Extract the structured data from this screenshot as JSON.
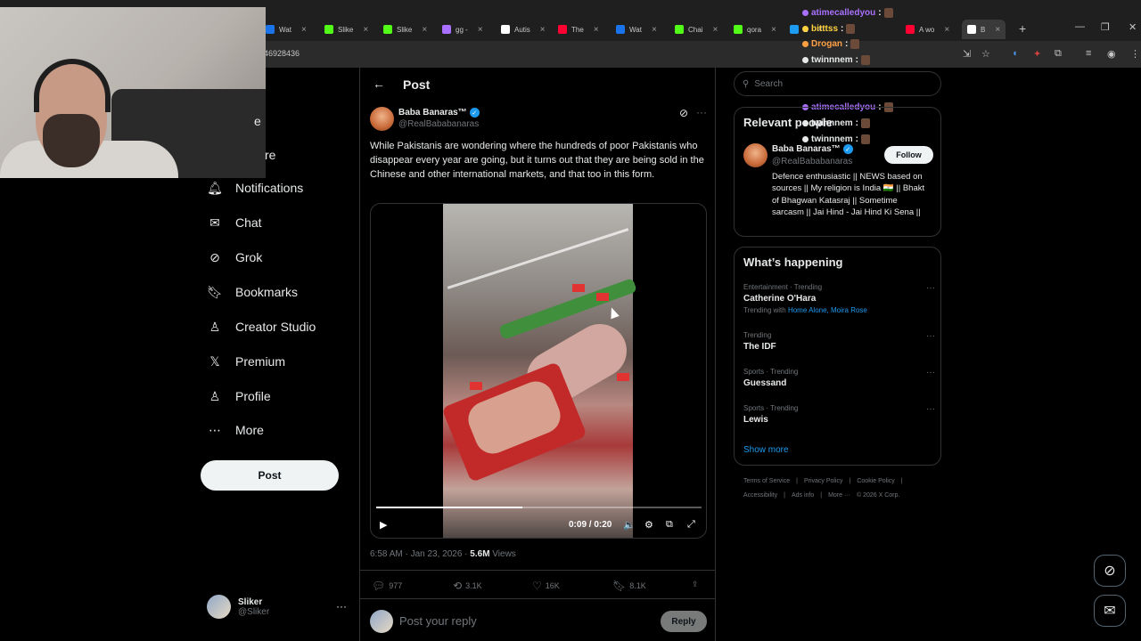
{
  "browser": {
    "tabs": [
      {
        "label": "Wat",
        "color": "#1a73e8"
      },
      {
        "label": "Slike",
        "color": "#53fc18"
      },
      {
        "label": "Slike",
        "color": "#53fc18"
      },
      {
        "label": "gg -",
        "color": "#a970ff"
      },
      {
        "label": "Autis",
        "color": "#ffffff"
      },
      {
        "label": "The",
        "color": "#ff0033"
      },
      {
        "label": "Wat",
        "color": "#1a73e8"
      },
      {
        "label": "Chai",
        "color": "#53fc18"
      },
      {
        "label": "qora",
        "color": "#53fc18"
      },
      {
        "label": "E",
        "color": "#1d9bf0"
      },
      {
        "label": "A wo",
        "color": "#ff0033"
      },
      {
        "label": "B",
        "color": "#ffffff"
      }
    ],
    "url": "46928436",
    "new_tab": "+",
    "minimize": "—",
    "maximize": "❐",
    "close": "✕"
  },
  "chat": [
    {
      "user": "atimecalledyou",
      "color": "#a970ff",
      "suffix": ":"
    },
    {
      "user": "bitttss",
      "color": "#ffd23f",
      "suffix": ":"
    },
    {
      "user": "Drogan",
      "color": "#ff9f43",
      "suffix": ":"
    },
    {
      "user": "twinnnem",
      "color": "#e7e9ea",
      "suffix": ":"
    },
    {
      "user": "twinnnem",
      "color": "#e7e9ea",
      "suffix": ":"
    },
    {
      "user": "twinnnem",
      "color": "#e7e9ea",
      "suffix": ":"
    },
    {
      "user": "atimecalledyou",
      "color": "#a970ff",
      "suffix": ":"
    },
    {
      "user": "twinnnem",
      "color": "#e7e9ea",
      "suffix": ":"
    },
    {
      "user": "twinnnem",
      "color": "#e7e9ea",
      "suffix": ":"
    }
  ],
  "sidebar": {
    "partial_1": "e",
    "partial_2": "re",
    "items": [
      {
        "label": "Notifications",
        "icon": "bell-icon"
      },
      {
        "label": "Chat",
        "icon": "mail-icon"
      },
      {
        "label": "Grok",
        "icon": "grok-icon"
      },
      {
        "label": "Bookmarks",
        "icon": "bookmark-icon"
      },
      {
        "label": "Creator Studio",
        "icon": "creator-icon"
      },
      {
        "label": "Premium",
        "icon": "x-icon"
      },
      {
        "label": "Profile",
        "icon": "person-icon"
      },
      {
        "label": "More",
        "icon": "more-circle-icon"
      }
    ],
    "post_button": "Post",
    "account": {
      "name": "Sliker",
      "handle": "@Sliker",
      "more": "···"
    }
  },
  "post": {
    "header_title": "Post",
    "author_name": "Baba Banaras™",
    "author_handle": "@RealBababanaras",
    "text": "While Pakistanis are wondering where the hundreds of poor Pakistanis who disappear every year are going, but it turns out that they are being sold in the Chinese and other international markets, and that too in this form.",
    "video": {
      "time": "0:09 / 0:20",
      "progress": 0.45
    },
    "time": "6:58 AM · Jan 23, 2026 · ",
    "views_count": "5.6M",
    "views_label": " Views",
    "stats": {
      "replies": "977",
      "reposts": "3.1K",
      "likes": "16K",
      "bookmarks": "8.1K"
    },
    "reply_placeholder": "Post your reply",
    "reply_button": "Reply"
  },
  "right": {
    "search_placeholder": "Search",
    "relevant_title": "Relevant people",
    "relevant": {
      "name": "Baba Banaras™",
      "handle": "@RealBababanaras",
      "follow": "Follow",
      "bio": "Defence enthusiastic || NEWS based on sources || My religion is India 🇮🇳 || Bhakt of Bhagwan Katasraj || Sometime sarcasm || Jai Hind - Jai Hind Ki Sena ||"
    },
    "happening_title": "What’s happening",
    "trends": [
      {
        "context": "Entertainment · Trending",
        "name": "Catherine O'Hara",
        "with_label": "Trending with ",
        "with": "Home Alone, Moira Rose"
      },
      {
        "context": "Trending",
        "name": "The IDF"
      },
      {
        "context": "Sports · Trending",
        "name": "Guessand"
      },
      {
        "context": "Sports · Trending",
        "name": "Lewis"
      }
    ],
    "show_more": "Show more",
    "footer_1": [
      "Terms of Service",
      "|",
      "Privacy Policy",
      "|",
      "Cookie Policy",
      "|"
    ],
    "footer_2": [
      "Accessibility",
      "|",
      "Ads info",
      "|",
      "More ···",
      "© 2026 X Corp."
    ]
  }
}
